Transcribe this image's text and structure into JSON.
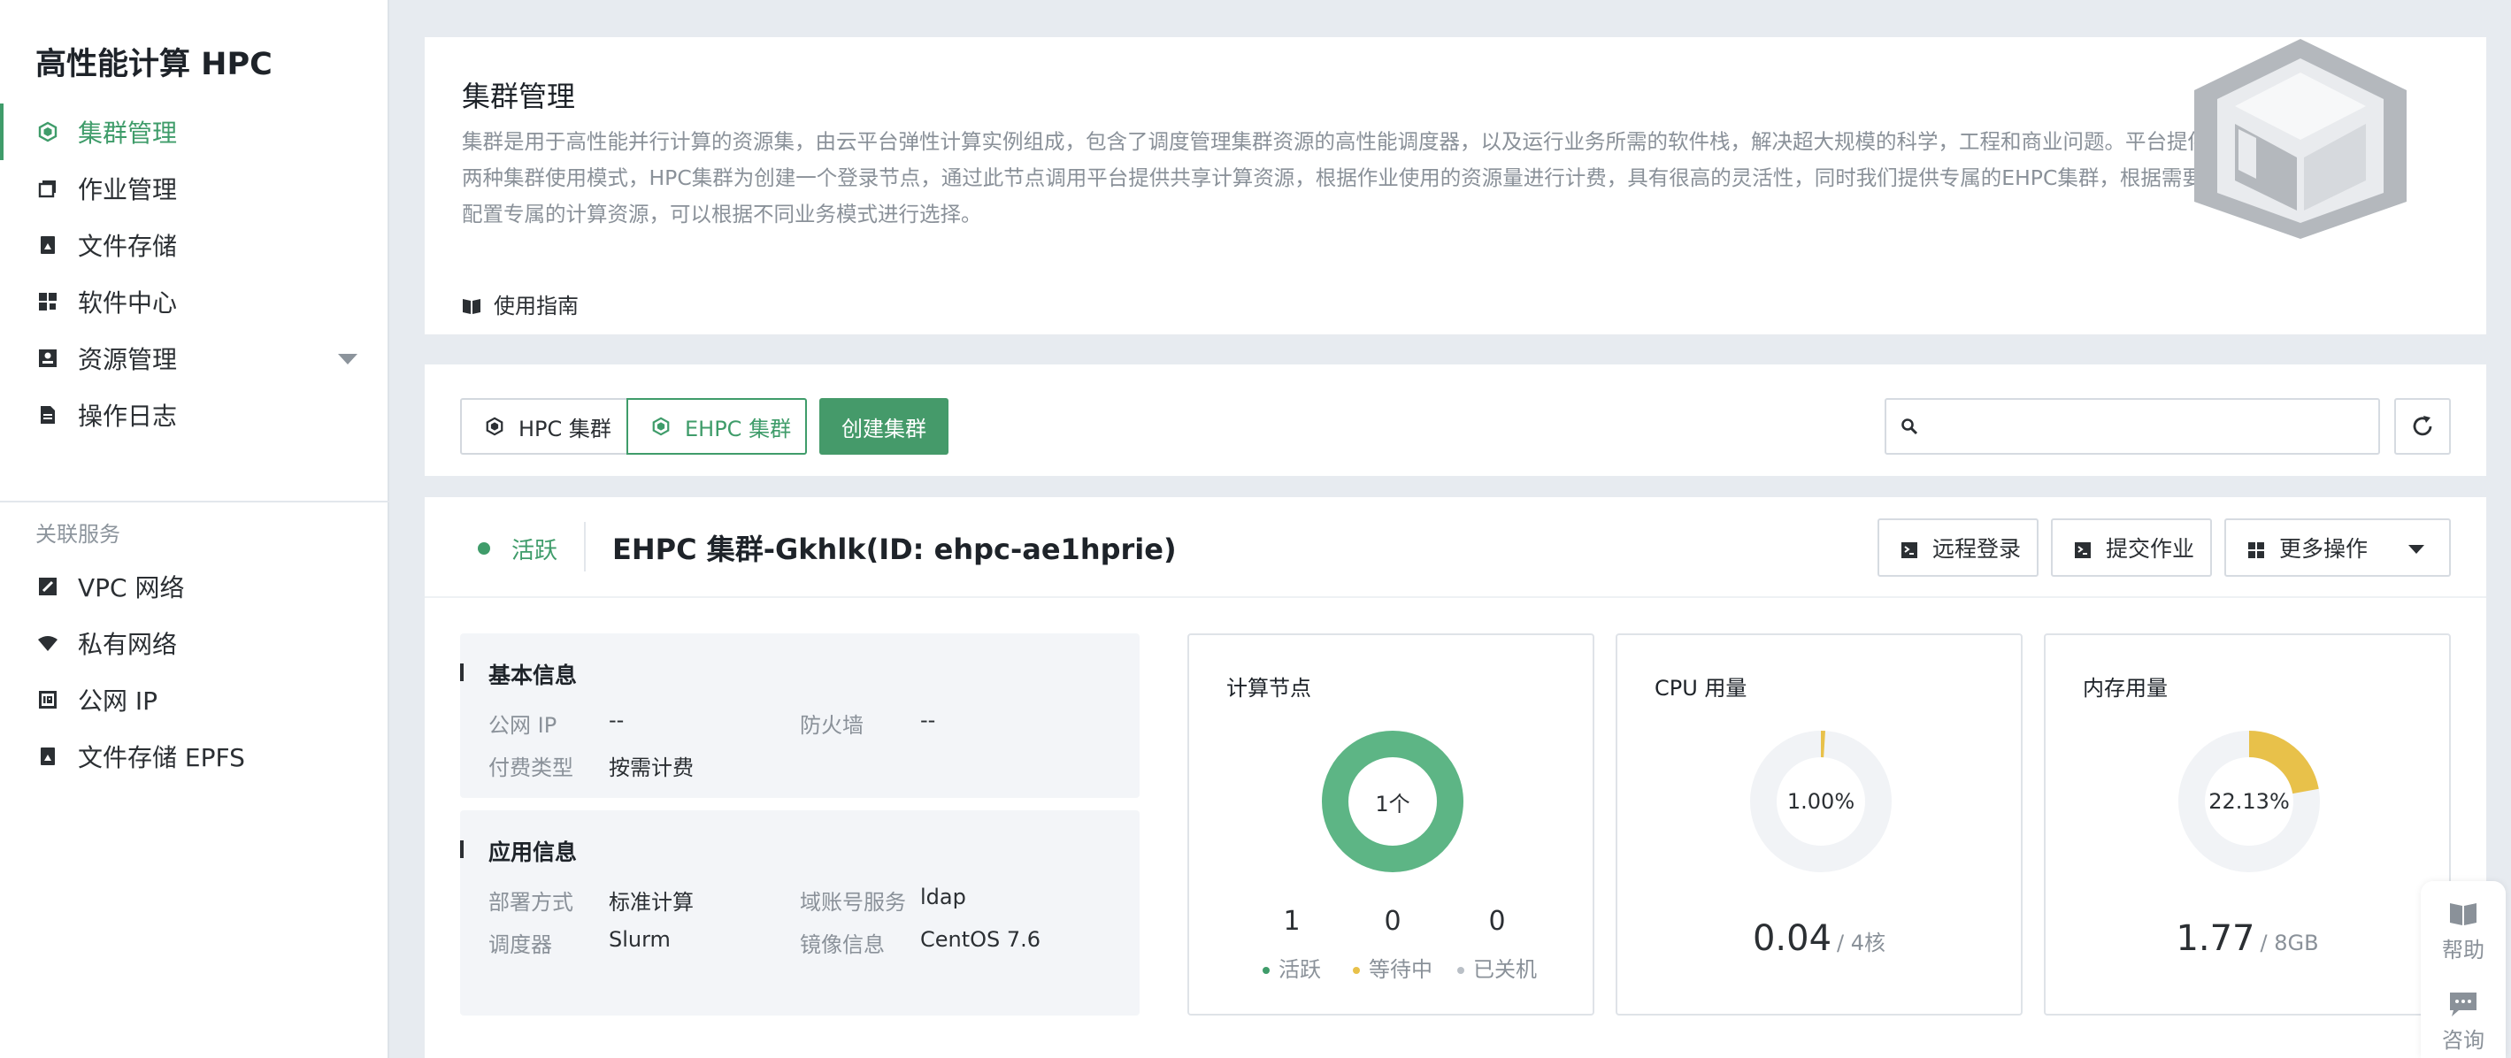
{
  "app": {
    "title": "高性能计算 HPC"
  },
  "sidebar": {
    "items": [
      {
        "label": "集群管理",
        "icon": "cluster-icon",
        "active": true
      },
      {
        "label": "作业管理",
        "icon": "job-icon"
      },
      {
        "label": "文件存储",
        "icon": "file-storage-icon"
      },
      {
        "label": "软件中心",
        "icon": "software-grid-icon"
      },
      {
        "label": "资源管理",
        "icon": "resource-icon",
        "expandable": true
      },
      {
        "label": "操作日志",
        "icon": "log-icon"
      }
    ],
    "section_label": "关联服务",
    "related": [
      {
        "label": "VPC 网络",
        "icon": "vpc-icon"
      },
      {
        "label": "私有网络",
        "icon": "wifi-icon"
      },
      {
        "label": "公网 IP",
        "icon": "ip-icon"
      },
      {
        "label": "文件存储 EPFS",
        "icon": "file-storage-icon"
      }
    ]
  },
  "intro": {
    "title": "集群管理",
    "description": "集群是用于高性能并行计算的资源集，由云平台弹性计算实例组成，包含了调度管理集群资源的高性能调度器，以及运行业务所需的软件栈，解决超大规模的科学，工程和商业问题。平台提供两种集群使用模式，HPC集群为创建一个登录节点，通过此节点调用平台提供共享计算资源，根据作业使用的资源量进行计费，具有很高的灵活性，同时我们提供专属的EHPC集群，根据需要配置专属的计算资源，可以根据不同业务模式进行选择。",
    "guide_label": "使用指南"
  },
  "toolbar": {
    "tabs": [
      {
        "label": "HPC 集群",
        "active": false
      },
      {
        "label": "EHPC 集群",
        "active": true
      }
    ],
    "create_label": "创建集群",
    "search_placeholder": ""
  },
  "cluster": {
    "status": "活跃",
    "name": "EHPC 集群-Gkhlk(ID: ehpc-ae1hprie)",
    "actions": {
      "remote": "远程登录",
      "submit": "提交作业",
      "more": "更多操作"
    },
    "basic": {
      "title": "基本信息",
      "fields": [
        {
          "label": "公网 IP",
          "value": "--"
        },
        {
          "label": "防火墙",
          "value": "--"
        },
        {
          "label": "付费类型",
          "value": "按需计费"
        }
      ]
    },
    "app": {
      "title": "应用信息",
      "fields": [
        {
          "label": "部署方式",
          "value": "标准计算"
        },
        {
          "label": "域账号服务",
          "value": "ldap"
        },
        {
          "label": "调度器",
          "value": "Slurm"
        },
        {
          "label": "镜像信息",
          "value": "CentOS 7.6"
        }
      ]
    },
    "nodes": {
      "title": "计算节点",
      "center_label": "1个",
      "counts": [
        {
          "value": "1",
          "label": "活跃",
          "color": "#3f9c6a"
        },
        {
          "value": "0",
          "label": "等待中",
          "color": "#e8c14a"
        },
        {
          "value": "0",
          "label": "已关机",
          "color": "#b9bfc6"
        }
      ]
    },
    "cpu": {
      "title": "CPU 用量",
      "percent_label": "1.00%",
      "fraction": 0.01,
      "value": "0.04",
      "unit": "/ 4核"
    },
    "memory": {
      "title": "内存用量",
      "percent_label": "22.13%",
      "fraction": 0.2213,
      "value": "1.77",
      "unit": "/ 8GB"
    }
  },
  "floater": {
    "help": "帮助",
    "consult": "咨询"
  },
  "colors": {
    "accent": "#3f9c6a",
    "donut_green": "#5db585",
    "donut_yellow": "#e8c14a",
    "donut_track": "#f1f3f6"
  }
}
